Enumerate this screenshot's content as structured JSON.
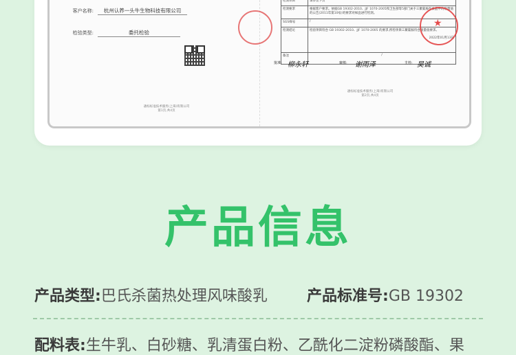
{
  "report": {
    "left_page": {
      "client_label": "客户名称:",
      "client_value": "杭州认养一头牛生物科技有限公司",
      "inspection_type_label": "检验类型:",
      "inspection_type_value": "委托检验",
      "footer_company": "通标标准技术服务(上海)有限公司",
      "footer_page": "第1页,共4页"
    },
    "right_page": {
      "rows": [
        {
          "key": "检测项目",
          "value": "请参见下页"
        },
        {
          "key": "检测要求",
          "value": "根据客户要求。依据GB 19302-2010、JJF 1070-2005和卫生部等5部门关于三聚氰胺在食品中的限量值的公告(2011年第10号)的要求对样品进行检测。"
        },
        {
          "key": "SGS样号",
          "value": "/"
        },
        {
          "key": "检测结论",
          "value": "检验项目符合 GB 19302-2010、JJF 1070-2005 的要求,所检项目三聚氰胺符合限量值要求。"
        },
        {
          "key": "备注",
          "value": "/"
        }
      ],
      "date": "2022年01月13日",
      "sign_labels": [
        "批准:",
        "审核:",
        "主检:"
      ],
      "footer_company": "通标标准技术服务(上海)有限公司",
      "footer_page": "第2页,共4页"
    }
  },
  "section_title": "产品信息",
  "info": {
    "product_type_label": "产品类型:",
    "product_type_value": "巴氏杀菌热处理风味酸乳",
    "standard_label": "产品标准号:",
    "standard_value": "GB 19302",
    "ingredients_label": "配料表:",
    "ingredients_value": "生牛乳、白砂糖、乳清蛋白粉、乙酰化二淀粉磷酸酯、果"
  }
}
